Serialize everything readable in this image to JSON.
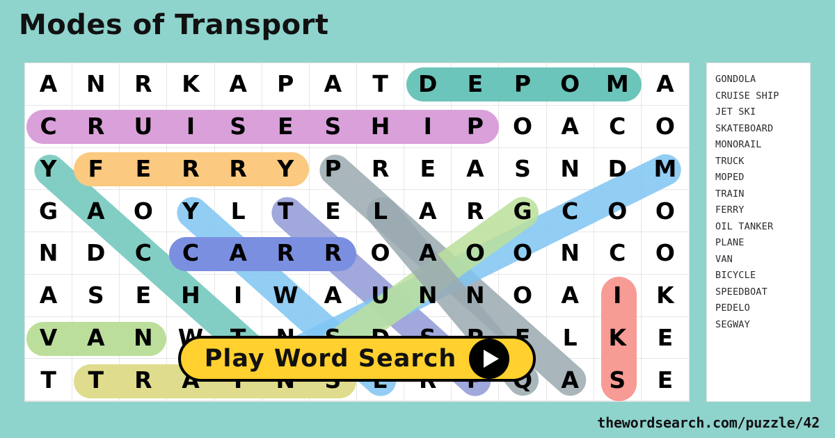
{
  "title": "Modes of Transport",
  "footer": {
    "url": "thewordsearch.com/puzzle/42"
  },
  "play_button": {
    "label": "Play Word Search",
    "icon": "play-triangle-icon"
  },
  "colors": {
    "background": "#8fd3cd",
    "panel": "#ffffff",
    "grid_line": "#e6e6e6",
    "button_fill": "#FFD02E",
    "button_border": "#000000",
    "text": "#000000"
  },
  "grid": {
    "columns": 14,
    "rows": 8,
    "letters": [
      [
        "A",
        "N",
        "R",
        "K",
        "A",
        "P",
        "A",
        "T",
        "D",
        "E",
        "P",
        "O",
        "M",
        "A"
      ],
      [
        "C",
        "R",
        "U",
        "I",
        "S",
        "E",
        "S",
        "H",
        "I",
        "P",
        "O",
        "A",
        "C",
        "O"
      ],
      [
        "Y",
        "F",
        "E",
        "R",
        "R",
        "Y",
        "P",
        "R",
        "E",
        "A",
        "S",
        "N",
        "D",
        "M"
      ],
      [
        "G",
        "A",
        "O",
        "Y",
        "L",
        "T",
        "E",
        "L",
        "A",
        "R",
        "G",
        "C",
        "O",
        "O"
      ],
      [
        "N",
        "D",
        "C",
        "C",
        "A",
        "R",
        "R",
        "O",
        "A",
        "O",
        "O",
        "N",
        "C",
        "O"
      ],
      [
        "A",
        "S",
        "E",
        "H",
        "I",
        "W",
        "A",
        "U",
        "N",
        "N",
        "O",
        "A",
        "I",
        "K"
      ],
      [
        "V",
        "A",
        "N",
        "W",
        "T",
        "N",
        "S",
        "D",
        "S",
        "P",
        "E",
        "L",
        "K",
        "E"
      ],
      [
        "T",
        "T",
        "R",
        "A",
        "I",
        "N",
        "S",
        "E",
        "R",
        "P",
        "Q",
        "A",
        "S",
        "E"
      ]
    ]
  },
  "highlights": {
    "straight": [
      {
        "word": "MOPED",
        "color": "#6cc5ba",
        "row": 0,
        "col_start": 8,
        "col_end": 12,
        "orientation": "horizontal"
      },
      {
        "word": "CRUISE SHIP",
        "color": "#d9a0da",
        "row": 1,
        "col_start": 0,
        "col_end": 9,
        "orientation": "horizontal"
      },
      {
        "word": "FERRY",
        "color": "#fbc97f",
        "row": 2,
        "col_start": 1,
        "col_end": 5,
        "orientation": "horizontal"
      },
      {
        "word": "CAR",
        "color": "#7b8fe0",
        "row": 4,
        "col_start": 3,
        "col_end": 6,
        "orientation": "horizontal"
      },
      {
        "word": "VAN",
        "color": "#bbdf9b",
        "row": 6,
        "col_start": 0,
        "col_end": 2,
        "orientation": "horizontal"
      },
      {
        "word": "TRAIN",
        "color": "#dfdc8e",
        "row": 7,
        "col_start": 1,
        "col_end": 6,
        "orientation": "horizontal"
      },
      {
        "word": "SKI",
        "color": "#f79b95",
        "col": 12,
        "row_start": 5,
        "row_end": 7,
        "orientation": "vertical"
      }
    ],
    "diagonal": [
      {
        "word": "GONDOLA",
        "color": "#6cc5ba",
        "row_start": 2,
        "col_start": 0,
        "row_end": 7,
        "col_end": 5,
        "direction": "down-right"
      },
      {
        "word": "TRUCK",
        "color": "#9aa9b0",
        "row_start": 2,
        "col_start": 6,
        "row_end": 7,
        "col_end": 11,
        "direction": "down-right"
      },
      {
        "word": "BICYCLE",
        "color": "#7fc4f2",
        "row_start": 3,
        "col_start": 3,
        "row_end": 7,
        "col_end": 7,
        "direction": "down-right"
      },
      {
        "word": "PEDELO",
        "color": "#9099d6",
        "row_start": 3,
        "col_start": 5,
        "row_end": 7,
        "col_end": 9,
        "direction": "down-right"
      },
      {
        "word": "MONORAIL",
        "color": "#7fc4f2",
        "row_start": 2,
        "col_start": 13,
        "row_end": 7,
        "col_end": 4,
        "direction": "down-left"
      },
      {
        "word": "SEGWAY",
        "color": "#bbdf9b",
        "row_start": 3,
        "col_start": 10,
        "row_end": 7,
        "col_end": 5,
        "direction": "down-left"
      },
      {
        "word": "SPEEDBOAT",
        "color": "#9aa9b0",
        "row_start": 3,
        "col_start": 7,
        "row_end": 7,
        "col_end": 10,
        "direction": "down-right-light"
      }
    ]
  },
  "word_list": {
    "items": [
      "GONDOLA",
      "CRUISE SHIP",
      "JET SKI",
      "SKATEBOARD",
      "MONORAIL",
      "TRUCK",
      "MOPED",
      "TRAIN",
      "FERRY",
      "OIL TANKER",
      "PLANE",
      "VAN",
      "BICYCLE",
      "SPEEDBOAT",
      "PEDELO",
      "SEGWAY"
    ]
  }
}
